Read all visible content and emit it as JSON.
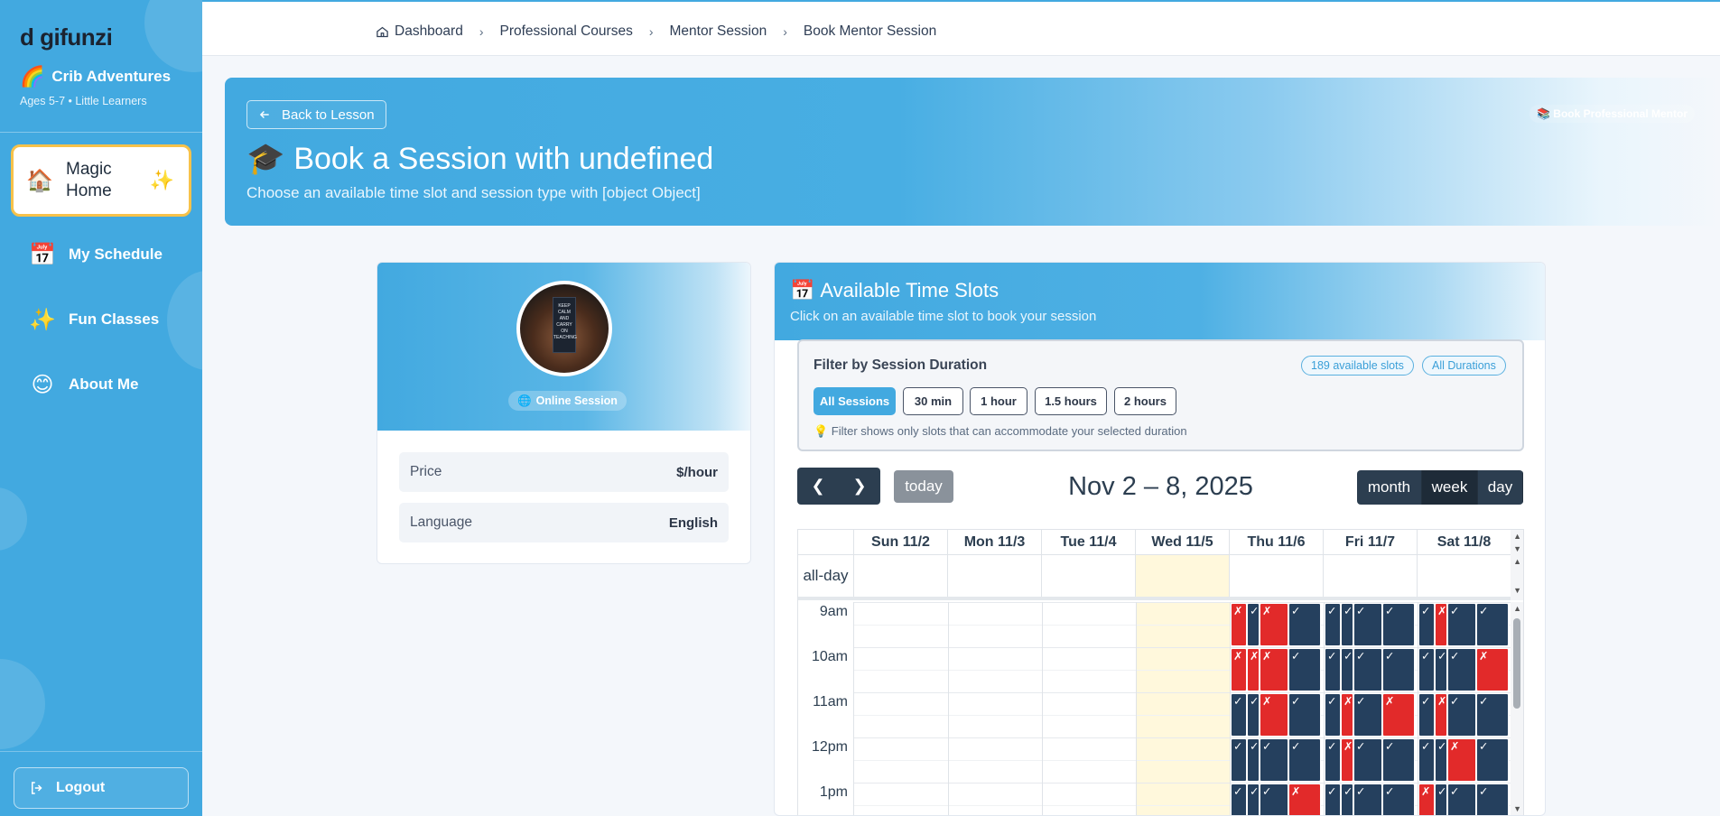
{
  "sidebar": {
    "logo": "d gifunzi",
    "brand": "Crib Adventures",
    "brand_icon": "🌈",
    "ages": "Ages 5-7  •  Little Learners",
    "items": [
      {
        "label": "Magic Home",
        "icon": "🏠",
        "active": true
      },
      {
        "label": "My Schedule",
        "icon": "📅"
      },
      {
        "label": "Fun Classes",
        "icon": "✨"
      },
      {
        "label": "About Me",
        "icon": "😊"
      }
    ],
    "active_sparkle": "✨",
    "logout": "Logout"
  },
  "breadcrumb": [
    "Dashboard",
    "Professional Courses",
    "Mentor Session",
    "Book Mentor Session"
  ],
  "hero": {
    "back": "Back to Lesson",
    "title": "Book a Session with undefined",
    "title_icon": "🎓",
    "subtitle": "Choose an available time slot and session type with [object Object]",
    "badge": "📚 Book Professional Mentor"
  },
  "profile": {
    "poster": "KEEP CALM AND CARRY ON TEACHING",
    "online": "Online Session",
    "price_label": "Price",
    "price_value": "$/hour",
    "language_label": "Language",
    "language_value": "English"
  },
  "slots": {
    "title": "Available Time Slots",
    "title_icon": "📅",
    "subtitle": "Click on an available time slot to book your session",
    "filter_title": "Filter by Session Duration",
    "count_pill": "189 available slots",
    "duration_pill": "All Durations",
    "durations": [
      "All Sessions",
      "30 min",
      "1 hour",
      "1.5 hours",
      "2 hours"
    ],
    "note": "💡 Filter shows only slots that can accommodate your selected duration"
  },
  "calendar": {
    "title": "Nov 2 – 8, 2025",
    "today": "today",
    "views": [
      "month",
      "week",
      "day"
    ],
    "active_view": "week",
    "days": [
      "Sun 11/2",
      "Mon 11/3",
      "Tue 11/4",
      "Wed 11/5",
      "Thu 11/6",
      "Fri 11/7",
      "Sat 11/8"
    ],
    "allday": "all-day",
    "hours": [
      "9am",
      "10am",
      "11am",
      "12pm",
      "1pm"
    ],
    "colors": {
      "available": "#25405e",
      "booked": "#e22a2a",
      "today": "#fff8dc"
    }
  }
}
